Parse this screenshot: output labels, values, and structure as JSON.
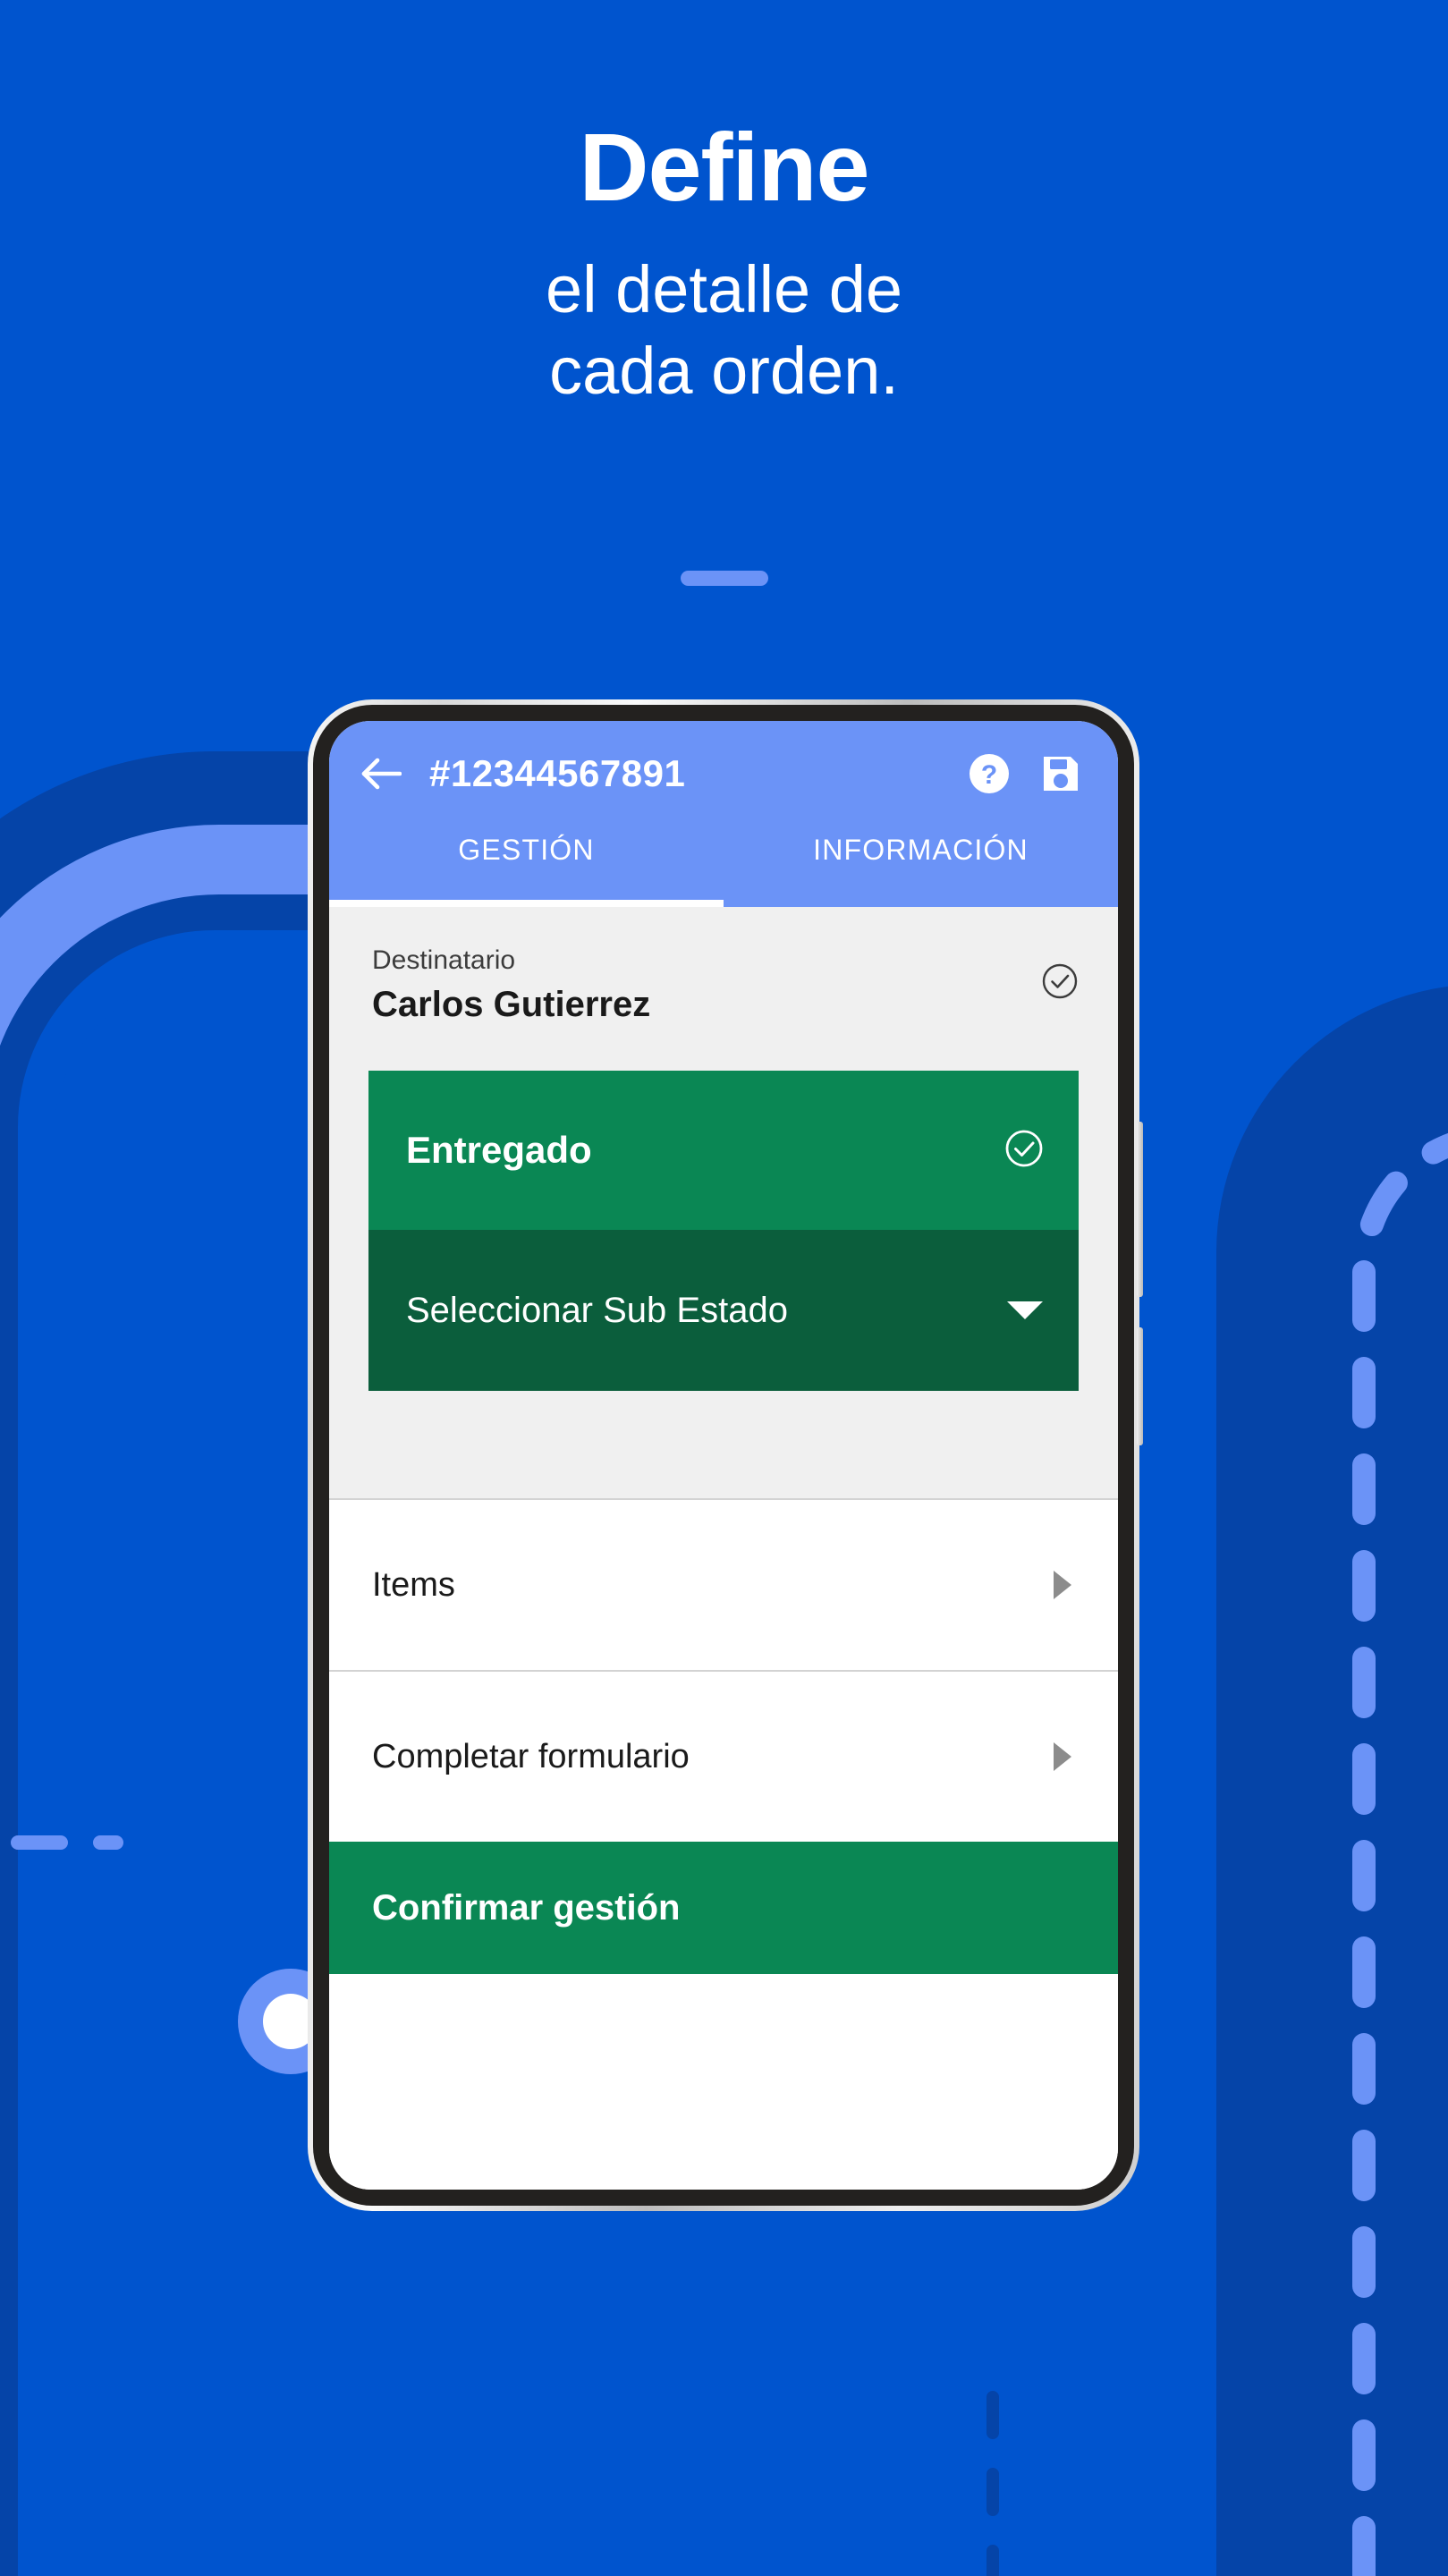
{
  "promo": {
    "headline": "Define",
    "subline_1": "el detalle de",
    "subline_2": "cada orden.",
    "background_color": "#0054CE",
    "accent_color": "#6B93F7",
    "divider_name": "divider-pill"
  },
  "app": {
    "header": {
      "background_color": "#6B93F7",
      "back_icon": "arrow-left-icon",
      "order_number": "#12344567891",
      "help_icon": "help-circle-icon",
      "save_icon": "save-floppy-icon"
    },
    "tabs": [
      {
        "label": "GESTIÓN",
        "active": true
      },
      {
        "label": "INFORMACIÓN",
        "active": false
      }
    ],
    "recipient": {
      "label": "Destinatario",
      "name": "Carlos Gutierrez",
      "status_icon": "check-circle-icon"
    },
    "status": {
      "main_label": "Entregado",
      "main_color": "#0A8754",
      "main_icon": "check-circle-icon",
      "sub_label": "Seleccionar Sub Estado",
      "sub_color": "#0B5E3C",
      "sub_icon": "chevron-down-icon"
    },
    "rows": [
      {
        "label": "Items",
        "icon": "chevron-right-icon"
      },
      {
        "label": "Completar formulario",
        "icon": "chevron-right-icon"
      }
    ],
    "confirm": {
      "label": "Confirmar gestión",
      "color": "#0A8754"
    }
  }
}
